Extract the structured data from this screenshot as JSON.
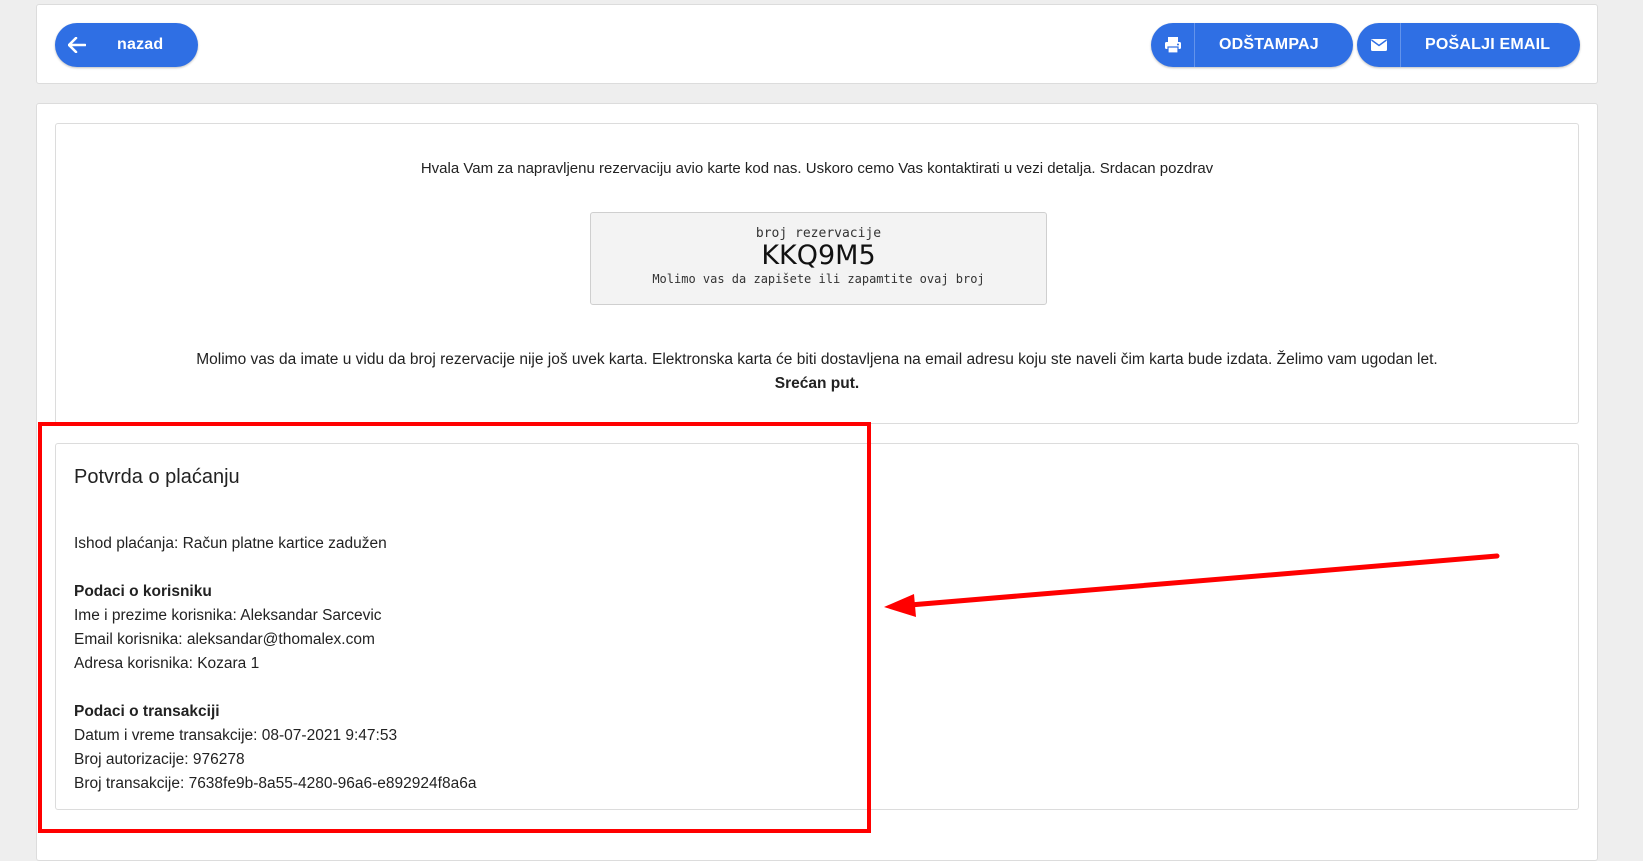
{
  "toolbar": {
    "back_label": "nazad",
    "print_label": "ODŠTAMPAJ",
    "email_label": "POŠALJI EMAIL"
  },
  "confirmation": {
    "thanks_text": "Hvala Vam za napravljenu rezervaciju avio karte kod nas. Uskoro cemo Vas kontaktirati u vezi detalja. Srdacan pozdrav",
    "reservation_label": "broj rezervacije",
    "reservation_code": "KKQ9M5",
    "reservation_note": "Molimo vas da zapišete ili zapamtite ovaj broj",
    "notice_text": "Molimo vas da imate u vidu da broj rezervacije nije još uvek karta. Elektronska karta će biti dostavljena na email adresu koju ste naveli čim karta bude izdata. Želimo vam ugodan let.",
    "farewell": "Srećan put."
  },
  "payment": {
    "title": "Potvrda o plaćanju",
    "outcome": "Ishod plaćanja: Račun platne kartice zadužen",
    "user_heading": "Podaci o korisniku",
    "user_name": "Ime i prezime korisnika: Aleksandar Sarcevic",
    "user_email": "Email korisnika: aleksandar@thomalex.com",
    "user_address": "Adresa korisnika: Kozara 1",
    "transaction_heading": "Podaci o transakciji",
    "transaction_datetime": "Datum i vreme transakcije: 08-07-2021 9:47:53",
    "authorization_number": "Broj autorizacije: 976278",
    "transaction_number": "Broj transakcije: 7638fe9b-8a55-4280-96a6-e892924f8a6a"
  },
  "colors": {
    "primary": "#2f6fe4",
    "annotation": "#ff0000"
  },
  "icons": {
    "back": "arrow-left-icon",
    "print": "printer-icon",
    "email": "envelope-icon"
  }
}
